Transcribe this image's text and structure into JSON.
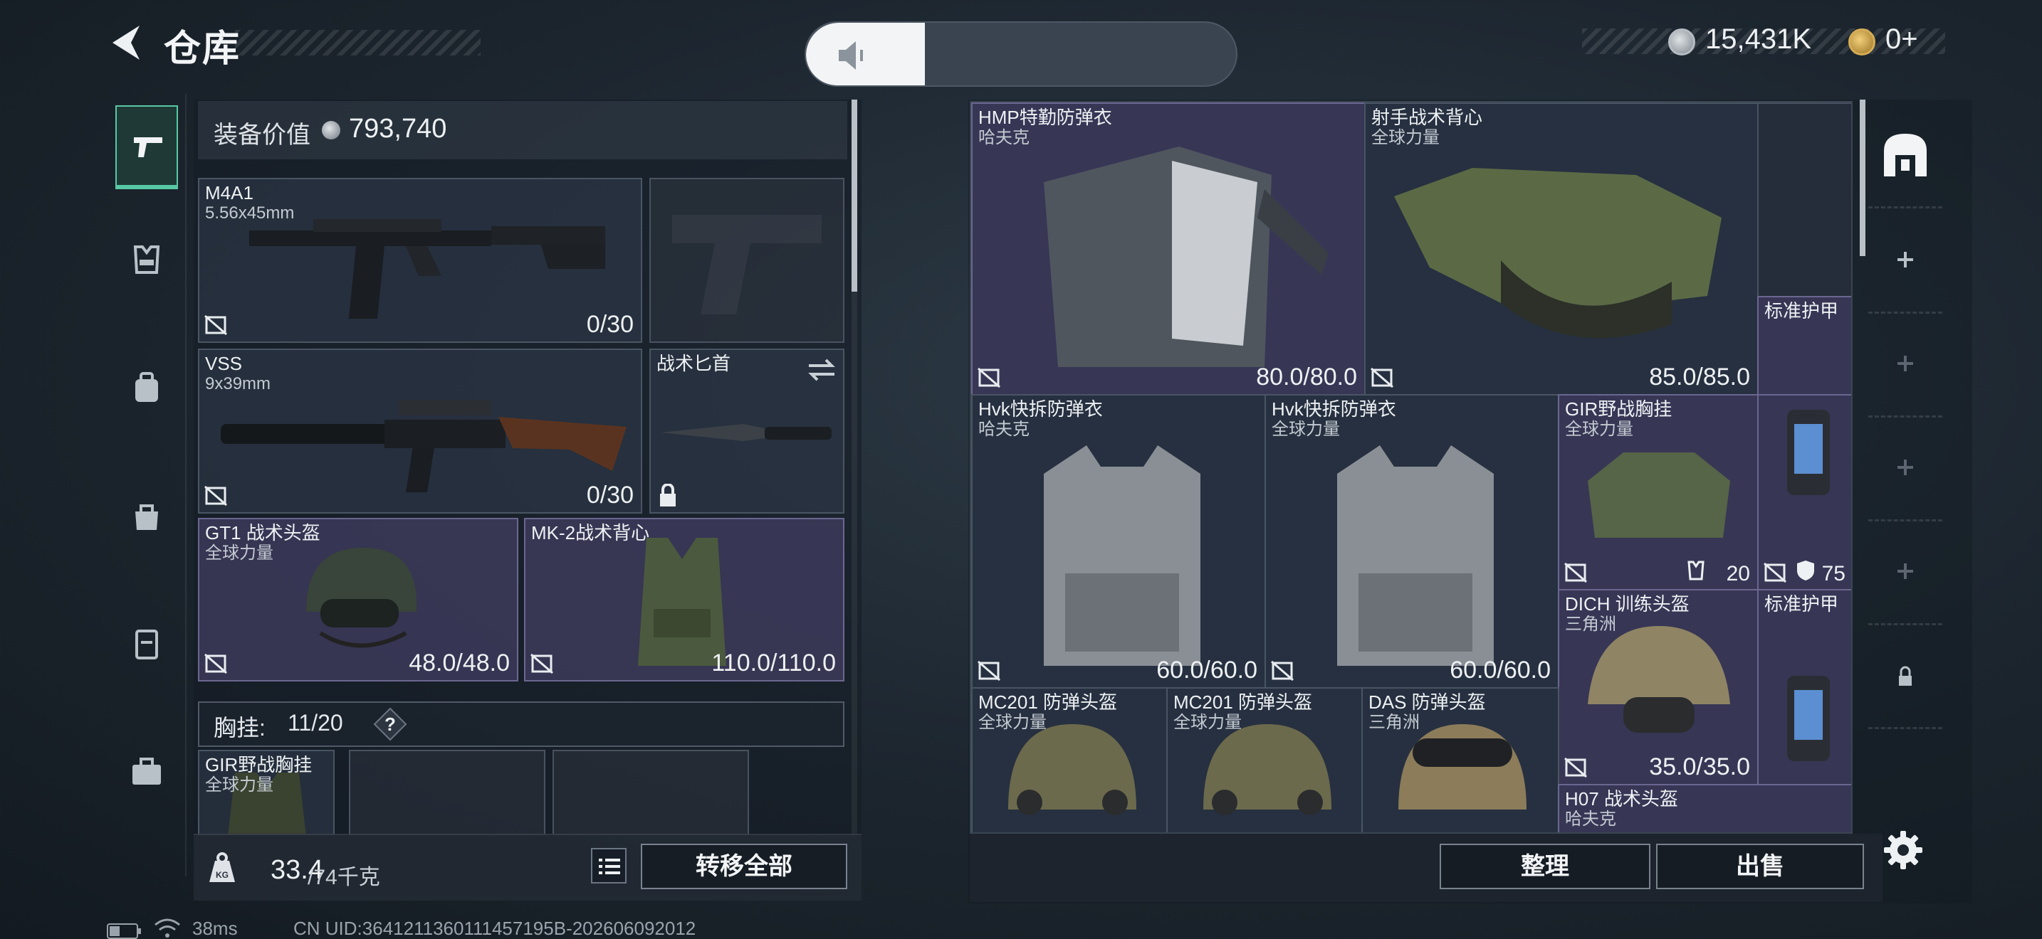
{
  "header": {
    "title": "仓库",
    "currencies": [
      {
        "value": "15,431K",
        "icon": "silver-coin-icon",
        "color": "#c9ced3"
      },
      {
        "value": "0+",
        "icon": "gold-coin-icon",
        "color": "#d5ad55"
      }
    ]
  },
  "left_tabs": [
    "weapon-icon",
    "chest-rig-icon",
    "backpack-icon",
    "bag-icon",
    "case-icon",
    "briefcase-icon"
  ],
  "loadout": {
    "value_label": "装备价值",
    "value": "793,740",
    "slots": [
      {
        "name": "M4A1",
        "sub": "5.56x45mm",
        "durability": "0/30"
      },
      {
        "name": "",
        "sub": "",
        "durability": ""
      },
      {
        "name": "VSS",
        "sub": "9x39mm",
        "durability": "0/30"
      },
      {
        "name": "战术匕首",
        "sub": "",
        "durability": ""
      },
      {
        "name": "GT1 战术头盔",
        "sub": "全球力量",
        "durability": "48.0/48.0"
      },
      {
        "name": "MK-2战术背心",
        "sub": "",
        "durability": "110.0/110.0"
      }
    ],
    "chest_rig": {
      "label": "胸挂:",
      "count": "11/20"
    },
    "rig_slots": [
      {
        "name": "GIR野战胸挂",
        "sub": "全球力量"
      }
    ],
    "weight": {
      "value": "33.4",
      "capacity": "/74千克"
    },
    "transfer_all_label": "转移全部"
  },
  "warehouse": {
    "items": [
      {
        "name": "HMP特勤防弹衣",
        "sub": "哈夫克",
        "value": "80.0/80.0"
      },
      {
        "name": "射手战术背心",
        "sub": "全球力量",
        "value": "85.0/85.0"
      },
      {
        "name": "",
        "sub": "",
        "value": ""
      },
      {
        "name": "标准护甲",
        "sub": "",
        "value": ""
      },
      {
        "name": "Hvk快拆防弹衣",
        "sub": "哈夫克",
        "value": "60.0/60.0"
      },
      {
        "name": "Hvk快拆防弹衣",
        "sub": "全球力量",
        "value": "60.0/60.0"
      },
      {
        "name": "GIR野战胸挂",
        "sub": "全球力量",
        "value": "20"
      },
      {
        "name": "",
        "sub": "",
        "value": "75"
      },
      {
        "name": "DICH 训练头盔",
        "sub": "三角洲",
        "value": "35.0/35.0"
      },
      {
        "name": "标准护甲",
        "sub": "",
        "value": ""
      },
      {
        "name": "MC201 防弹头盔",
        "sub": "全球力量",
        "value": ""
      },
      {
        "name": "MC201 防弹头盔",
        "sub": "全球力量",
        "value": ""
      },
      {
        "name": "DAS 防弹头盔",
        "sub": "三角洲",
        "value": ""
      },
      {
        "name": "H07 战术头盔",
        "sub": "哈夫克",
        "value": ""
      }
    ],
    "sort_label": "整理",
    "sell_label": "出售"
  },
  "status": {
    "ping": "38ms",
    "uid": "CN UID:3641211360111457195B-202606092012"
  },
  "colors": {
    "accent": "#57c9a4",
    "slot_purple": "#423e62",
    "slot_blue": "#26344a"
  }
}
